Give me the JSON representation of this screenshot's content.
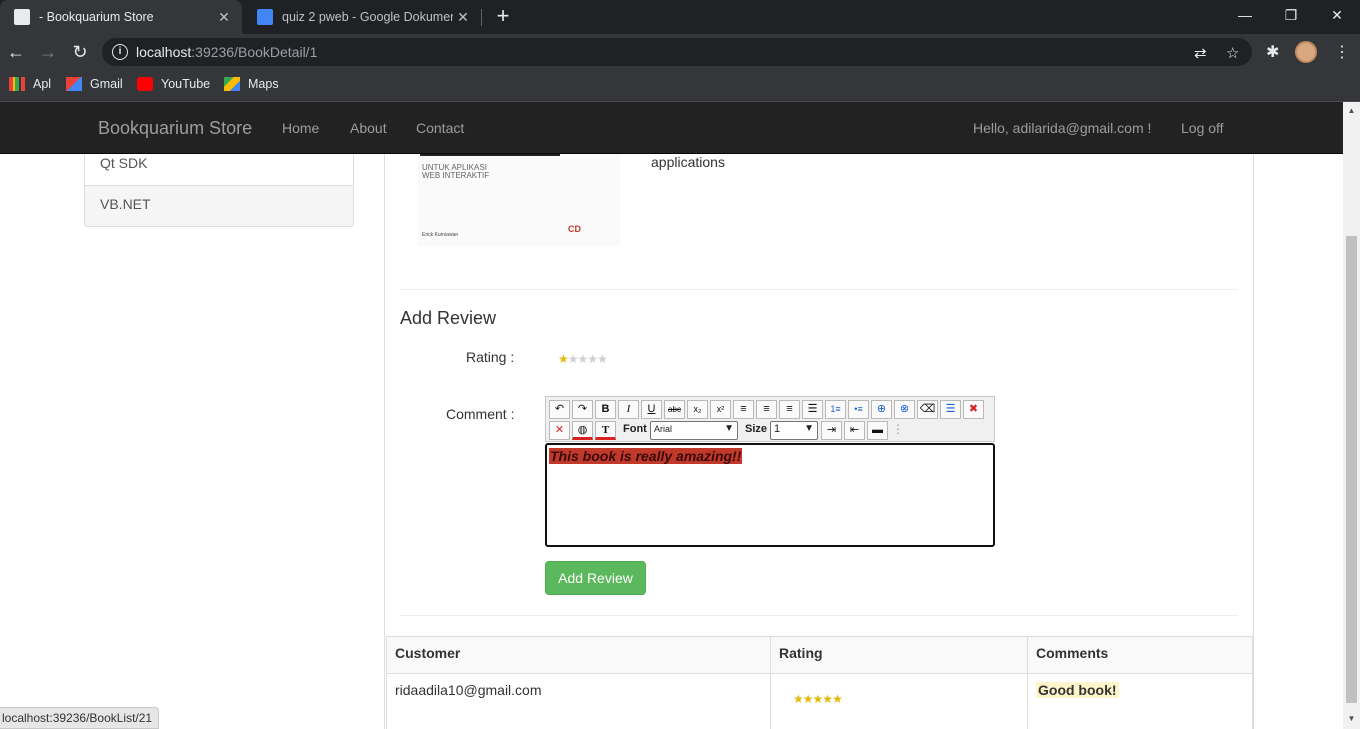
{
  "browser": {
    "tabs": [
      {
        "title": "- Bookquarium Store",
        "active": true
      },
      {
        "title": "quiz 2 pweb - Google Dokumen",
        "active": false
      }
    ],
    "url_host": "localhost",
    "url_rest": ":39236/BookDetail/1",
    "bookmarks": [
      "Apl",
      "Gmail",
      "YouTube",
      "Maps"
    ],
    "status_url": "localhost:39236/BookList/21"
  },
  "navbar": {
    "brand": "Bookquarium Store",
    "links": [
      "Home",
      "About",
      "Contact"
    ],
    "greeting": "Hello, adilarida@gmail.com !",
    "logoff": "Log off"
  },
  "sidebar": {
    "items": [
      "Qt SDK",
      "VB.NET"
    ]
  },
  "book": {
    "cover_subtitle": "UNTUK APLIKASI WEB INTERAKTIF",
    "cover_author": "Erick Kurniawan",
    "cover_badge": "CD",
    "description_tail": "applications"
  },
  "review_form": {
    "heading": "Add Review",
    "rating_label": "Rating :",
    "rating_value": 1,
    "rating_max": 5,
    "comment_label": "Comment :",
    "toolbar": {
      "font_label": "Font",
      "font_value": "Arial",
      "size_label": "Size",
      "size_value": "1"
    },
    "comment_text": "This book is really amazing!!",
    "submit_label": "Add Review"
  },
  "reviews": {
    "headers": [
      "Customer",
      "Rating",
      "Comments"
    ],
    "rows": [
      {
        "customer": "ridaadila10@gmail.com",
        "rating": 5,
        "comment": "Good book!"
      }
    ]
  },
  "colors": {
    "accent_green": "#5cb85c",
    "navbar_bg": "#222222",
    "comment_highlight": "#c0392b",
    "star": "#e5b90a"
  }
}
